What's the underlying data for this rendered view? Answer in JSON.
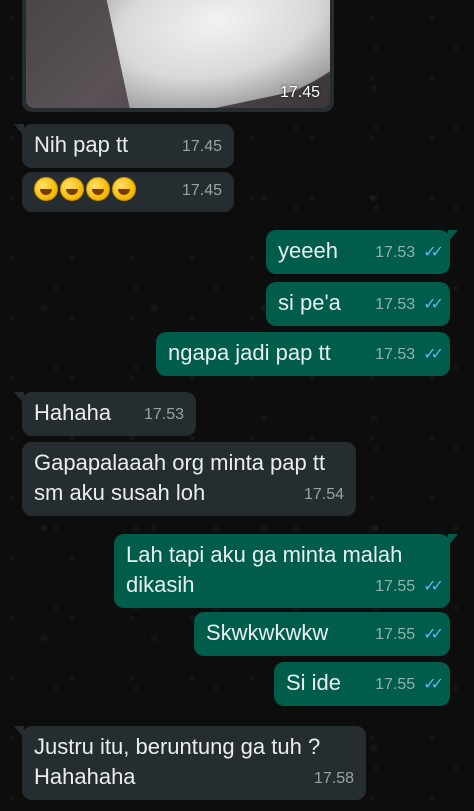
{
  "image_message": {
    "time": "17.45"
  },
  "messages": [
    {
      "id": "m1",
      "dir": "in",
      "text": "Nih pap tt",
      "time": "17.45"
    },
    {
      "id": "m2",
      "dir": "in",
      "text": "🤣🤣🤣🤣",
      "time": "17.45"
    },
    {
      "id": "m3",
      "dir": "out",
      "text": "yeeeh",
      "time": "17.53"
    },
    {
      "id": "m4",
      "dir": "out",
      "text": "si pe'a",
      "time": "17.53"
    },
    {
      "id": "m5",
      "dir": "out",
      "text": "ngapa jadi pap tt",
      "time": "17.53"
    },
    {
      "id": "m6",
      "dir": "in",
      "text": "Hahaha",
      "time": "17.53"
    },
    {
      "id": "m7",
      "dir": "in",
      "text": "Gapapalaaah org minta pap tt sm aku susah loh",
      "time": "17.54"
    },
    {
      "id": "m8",
      "dir": "out",
      "text": "Lah tapi aku ga minta malah dikasih",
      "time": "17.55"
    },
    {
      "id": "m9",
      "dir": "out",
      "text": "Skwkwkwkw",
      "time": "17.55"
    },
    {
      "id": "m10",
      "dir": "out",
      "text": "Si ide",
      "time": "17.55"
    },
    {
      "id": "m11",
      "dir": "in",
      "text": "Justru itu, beruntung ga tuh ? Hahahaha",
      "time": "17.58"
    }
  ],
  "colors": {
    "incoming": "#262d31",
    "outgoing": "#005c4b",
    "read_ticks": "#53bdeb",
    "background": "#0b0b0b"
  },
  "icons": {
    "read_receipt": "double-check-icon"
  }
}
